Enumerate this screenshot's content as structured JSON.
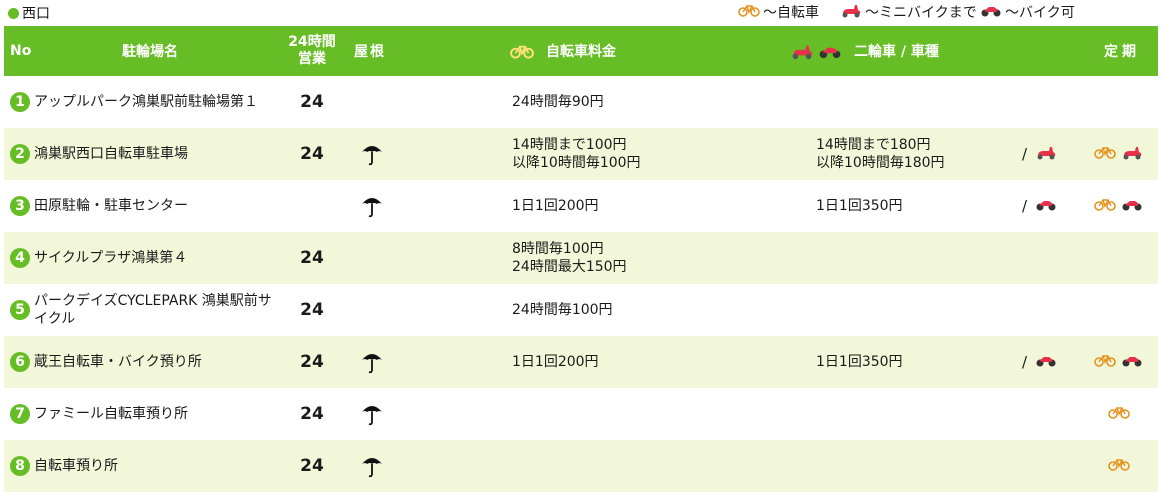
{
  "section": {
    "label": "西口"
  },
  "legend": {
    "bicycle": "～自転車",
    "minibike": "～ミニバイクまで",
    "motorbike": "～バイク可"
  },
  "header": {
    "no": "No",
    "name": "駐輪場名",
    "hours_line1": "24時間",
    "hours_line2": "営業",
    "roof": "屋根",
    "bicycle_fee": "自転車料金",
    "motorcycle": "二輪車 / 車種",
    "season": "定期"
  },
  "icons": {
    "bicycle": "bicycle-icon",
    "minibike": "scooter-icon",
    "motorbike": "motorbike-icon",
    "roof": "umbrella-icon"
  },
  "colors": {
    "accent": "#67bd25",
    "alt_row": "#f3f7d9",
    "bike": "#e3931e",
    "scooter": "#e8304a"
  },
  "rows": [
    {
      "no": "1",
      "name": "アップルパーク鴻巣駅前駐輪場第１",
      "hours": "24",
      "roof": false,
      "bike_fee": [
        "24時間毎90円"
      ],
      "moto_fee": [],
      "moto_types": [],
      "season": []
    },
    {
      "no": "2",
      "name": "鴻巣駅西口自転車駐車場",
      "hours": "24",
      "roof": true,
      "bike_fee": [
        "14時間まで100円",
        "以降10時間毎100円"
      ],
      "moto_fee": [
        "14時間まで180円",
        "以降10時間毎180円"
      ],
      "moto_types": [
        "minibike"
      ],
      "season": [
        "bicycle",
        "minibike"
      ]
    },
    {
      "no": "3",
      "name": "田原駐輪・駐車センター",
      "hours": "",
      "roof": true,
      "bike_fee": [
        "1日1回200円"
      ],
      "moto_fee": [
        "1日1回350円"
      ],
      "moto_types": [
        "motorbike"
      ],
      "season": [
        "bicycle",
        "motorbike"
      ]
    },
    {
      "no": "4",
      "name": "サイクルプラザ鴻巣第４",
      "hours": "24",
      "roof": false,
      "bike_fee": [
        "8時間毎100円",
        "24時間最大150円"
      ],
      "moto_fee": [],
      "moto_types": [],
      "season": []
    },
    {
      "no": "5",
      "name": "パークデイズCYCLEPARK 鴻巣駅前サイクル",
      "hours": "24",
      "roof": false,
      "bike_fee": [
        "24時間毎100円"
      ],
      "moto_fee": [],
      "moto_types": [],
      "season": []
    },
    {
      "no": "6",
      "name": "蔵王自転車・バイク預り所",
      "hours": "24",
      "roof": true,
      "bike_fee": [
        "1日1回200円"
      ],
      "moto_fee": [
        "1日1回350円"
      ],
      "moto_types": [
        "motorbike"
      ],
      "season": [
        "bicycle",
        "motorbike"
      ]
    },
    {
      "no": "7",
      "name": "ファミール自転車預り所",
      "hours": "24",
      "roof": true,
      "bike_fee": [],
      "moto_fee": [],
      "moto_types": [],
      "season": [
        "bicycle"
      ]
    },
    {
      "no": "8",
      "name": "自転車預り所",
      "hours": "24",
      "roof": true,
      "bike_fee": [],
      "moto_fee": [],
      "moto_types": [],
      "season": [
        "bicycle"
      ]
    }
  ]
}
